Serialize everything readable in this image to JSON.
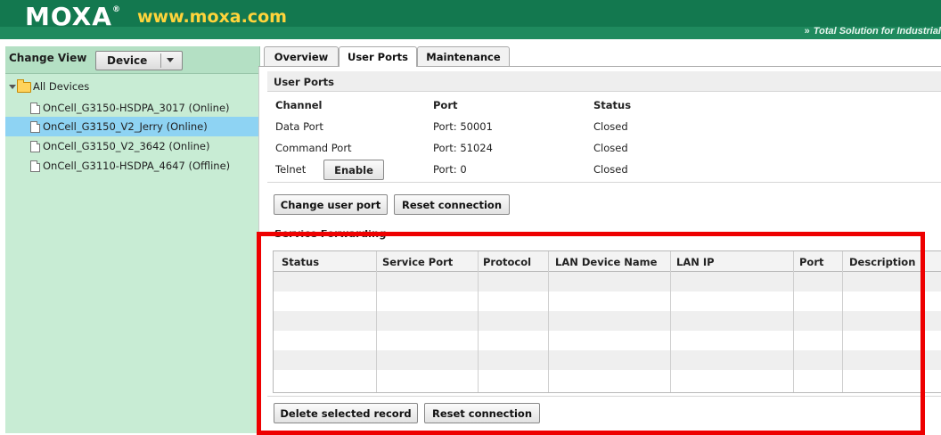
{
  "header": {
    "logo": "MOXA",
    "logo_mark": "®",
    "url": "www.moxa.com",
    "tagline": "Total Solution for Industrial",
    "tagline_icon": "double-chevron-right-icon",
    "colors": {
      "band": "#13784f",
      "bar": "#1f8a5e",
      "url": "#ffd43b"
    }
  },
  "sidebar": {
    "change_view_label": "Change View",
    "view_select": "Device",
    "tree_root": "All Devices",
    "devices": [
      {
        "label": "OnCell_G3150-HSDPA_3017 (Online)",
        "selected": false
      },
      {
        "label": "OnCell_G3150_V2_Jerry (Online)",
        "selected": true
      },
      {
        "label": "OnCell_G3150_V2_3642 (Online)",
        "selected": false
      },
      {
        "label": "OnCell_G3110-HSDPA_4647 (Offline)",
        "selected": false
      }
    ],
    "colors": {
      "pane": "#c8ecd4",
      "selected": "#8ed3f3"
    }
  },
  "tabs": [
    {
      "label": "Overview",
      "active": false
    },
    {
      "label": "User Ports",
      "active": true
    },
    {
      "label": "Maintenance",
      "active": false
    }
  ],
  "user_ports": {
    "title": "User Ports",
    "columns": [
      "Channel",
      "Port",
      "Status"
    ],
    "rows": [
      {
        "channel": "Data Port",
        "port": "Port: 50001",
        "status": "Closed"
      },
      {
        "channel": "Command Port",
        "port": "Port: 51024",
        "status": "Closed"
      },
      {
        "channel": "Telnet",
        "button": "Enable",
        "port": "Port: 0",
        "status": "Closed"
      }
    ],
    "buttons": {
      "change_user_port": "Change user port",
      "reset_connection": "Reset connection"
    }
  },
  "service_forwarding": {
    "title": "Service Forwarding",
    "columns": [
      "Status",
      "Service Port",
      "Protocol",
      "LAN Device Name",
      "LAN IP",
      "Port",
      "Description"
    ],
    "rows": [],
    "buttons": {
      "delete_selected": "Delete selected record",
      "reset_connection": "Reset connection"
    }
  },
  "highlight_color": "#ee0000"
}
